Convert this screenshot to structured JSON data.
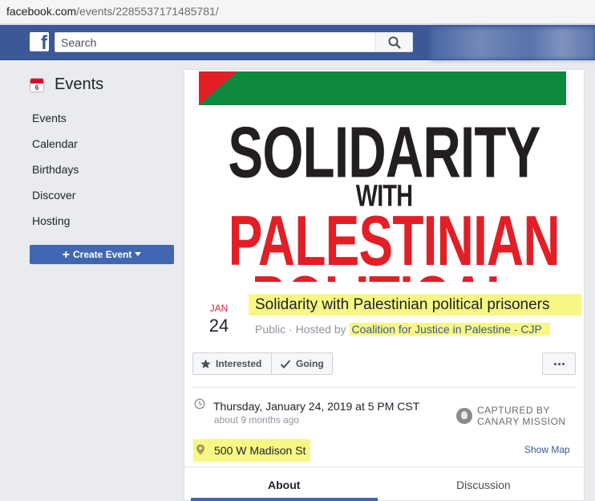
{
  "browser": {
    "url_host": "facebook.com",
    "url_path": "/events/2285537171485781/"
  },
  "topbar": {
    "search_placeholder": "Search",
    "logo": "f"
  },
  "sidebar": {
    "heading": "Events",
    "calendar_day": "6",
    "items": [
      {
        "label": "Events"
      },
      {
        "label": "Calendar"
      },
      {
        "label": "Birthdays"
      },
      {
        "label": "Discover"
      },
      {
        "label": "Hosting"
      }
    ],
    "create_label": "Create Event"
  },
  "cover": {
    "lines": [
      "SOLIDARITY",
      "WITH",
      "PALESTINIAN",
      "POLITICAL"
    ],
    "colors": {
      "flag_green": "#0d8a3e",
      "flag_red": "#e21e26",
      "text_black": "#231f20",
      "text_red": "#e21e26"
    }
  },
  "event": {
    "month": "JAN",
    "day": "24",
    "title": "Solidarity with Palestinian political prisoners",
    "privacy": "Public",
    "hosted_by_label": "Hosted by",
    "host": "Coalition for Justice in Palestine - CJP",
    "datetime": "Thursday, January 24, 2019 at 5 PM CST",
    "relative_time": "about 9 months ago",
    "location": "500 W Madison St",
    "show_map_label": "Show Map"
  },
  "actions": {
    "interested_label": "Interested",
    "going_label": "Going"
  },
  "watermark": {
    "line1": "CAPTURED BY",
    "line2": "CANARY MISSION"
  },
  "tabs": [
    {
      "label": "About",
      "active": true
    },
    {
      "label": "Discussion",
      "active": false
    }
  ],
  "colors": {
    "fb_blue": "#3b5998",
    "button_blue": "#4267b2",
    "highlight": "#f7f784",
    "link": "#365899"
  }
}
